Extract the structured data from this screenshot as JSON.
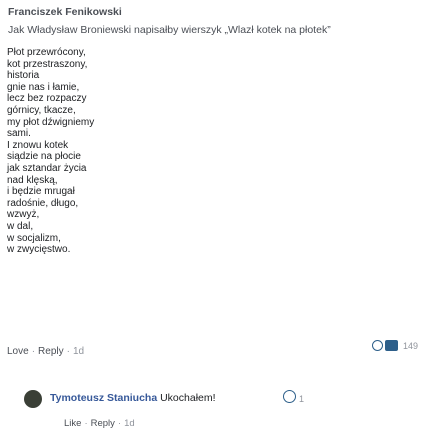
{
  "post": {
    "author": "Franciszek Fenikowski",
    "title": "Jak Władysław Broniewski napisałby wierszyk „Wlazł kotek na płotek”",
    "poem": [
      "Płot przewrócony,",
      "kot przestraszony,",
      "historia",
      "gnie nas i łamie,",
      "lecz bez rozpaczy",
      "górnicy, tkacze,",
      "my płot dźwigniemy",
      "sami.",
      "I znowu kotek",
      "siądzie na płocie",
      "jak sztandar życia",
      "nad klęską,",
      "i będzie mrugał",
      "radośnie, długo,",
      "wzwyż,",
      "w dal,",
      "w socjalizm,",
      "w zwycięstwo."
    ],
    "actions": {
      "love": "Love",
      "reply": "Reply",
      "time": "1d"
    },
    "reaction_count": "149",
    "reaction_icons": [
      "care-icon",
      "like-icon"
    ]
  },
  "reply": {
    "author": "Tymoteusz Staniucha",
    "text": "Ukochałem!",
    "reaction_count": "1",
    "actions": {
      "like": "Like",
      "reply": "Reply",
      "time": "1d"
    }
  },
  "colors": {
    "text": "#1c1e21",
    "muted": "#90949c",
    "link": "#365899",
    "reaction": "#2d5f8a"
  }
}
